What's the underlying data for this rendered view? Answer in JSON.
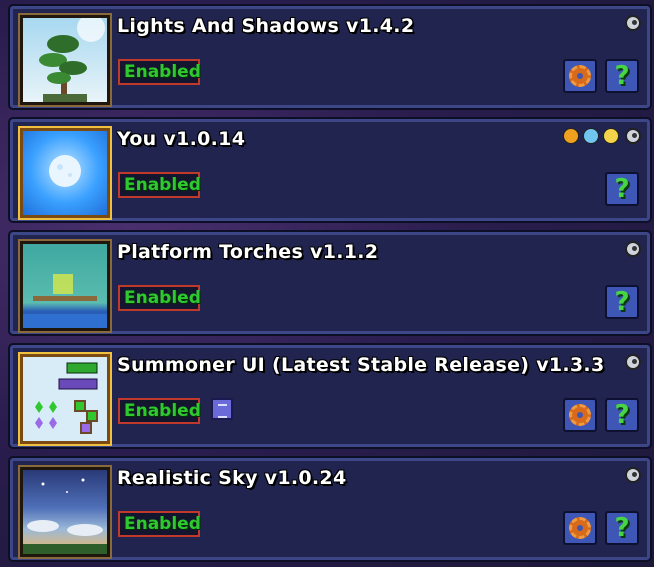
{
  "mods": [
    {
      "title": "Lights And Shadows v1.4.2",
      "status": "Enabled",
      "has_config": true,
      "icon": "tree-thumbnail"
    },
    {
      "title": "You v1.0.14",
      "status": "Enabled",
      "has_config": false,
      "icon": "moon-thumbnail"
    },
    {
      "title": "Platform Torches v1.1.2",
      "status": "Enabled",
      "has_config": false,
      "icon": "platform-thumbnail"
    },
    {
      "title": "Summoner UI (Latest Stable Release) v1.3.3",
      "status": "Enabled",
      "has_config": true,
      "icon": "summoner-ui-thumbnail"
    },
    {
      "title": "Realistic Sky v1.0.24",
      "status": "Enabled",
      "has_config": true,
      "icon": "sky-thumbnail"
    }
  ],
  "help_label": "?",
  "colors": {
    "panel_bg": "#20244f",
    "panel_border": "#3d4687",
    "enabled_text": "#2fc92f",
    "enabled_border": "#c0392b",
    "button_bg": "#3e57b7"
  }
}
